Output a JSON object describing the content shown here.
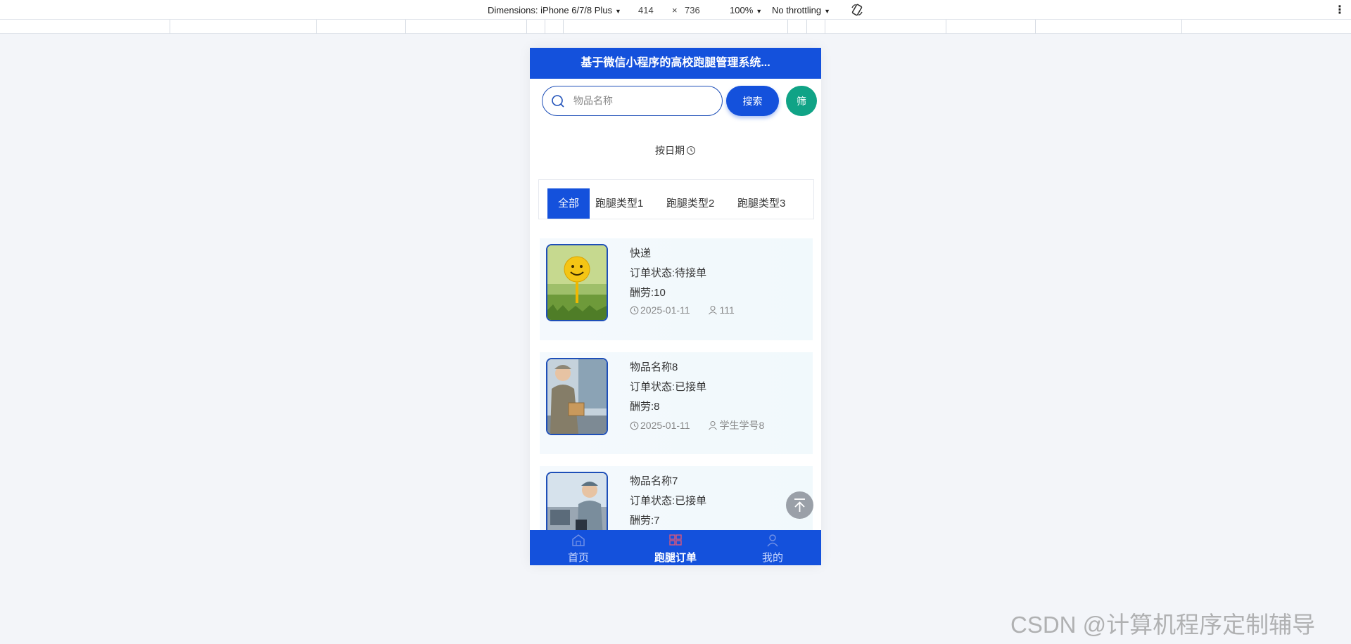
{
  "devtools": {
    "dimensions_label": "Dimensions: iPhone 6/7/8 Plus",
    "width": "414",
    "times": "×",
    "height": "736",
    "zoom": "100%",
    "throttling": "No throttling"
  },
  "app": {
    "title": "基于微信小程序的高校跑腿管理系统...",
    "search": {
      "placeholder": "物品名称",
      "button_label": "搜索",
      "filter_label": "筛"
    },
    "sort_label": "按日期",
    "tabs": [
      {
        "label": "全部",
        "active": true
      },
      {
        "label": "跑腿类型1",
        "active": false
      },
      {
        "label": "跑腿类型2",
        "active": false
      },
      {
        "label": "跑腿类型3",
        "active": false
      }
    ],
    "orders": [
      {
        "name": "快递",
        "status": "订单状态:待接单",
        "reward": "酬劳:10",
        "date": "2025-01-11",
        "user": "111",
        "image": "smiley-golf-ball"
      },
      {
        "name": "物品名称8",
        "status": "订单状态:已接单",
        "reward": "酬劳:8",
        "date": "2025-01-11",
        "user": "学生学号8",
        "image": "courier-with-box"
      },
      {
        "name": "物品名称7",
        "status": "订单状态:已接单",
        "reward": "酬劳:7",
        "date": "",
        "user": "",
        "image": "courier-with-tablet"
      }
    ],
    "tabbar": [
      {
        "label": "首页",
        "icon": "home-icon",
        "active": false
      },
      {
        "label": "跑腿订单",
        "icon": "order-grid-icon",
        "active": true
      },
      {
        "label": "我的",
        "icon": "user-icon",
        "active": false
      }
    ],
    "colors": {
      "primary": "#1451dc",
      "filter": "#10a386",
      "border": "#1e4fb8"
    }
  },
  "watermark": "CSDN @计算机程序定制辅导"
}
